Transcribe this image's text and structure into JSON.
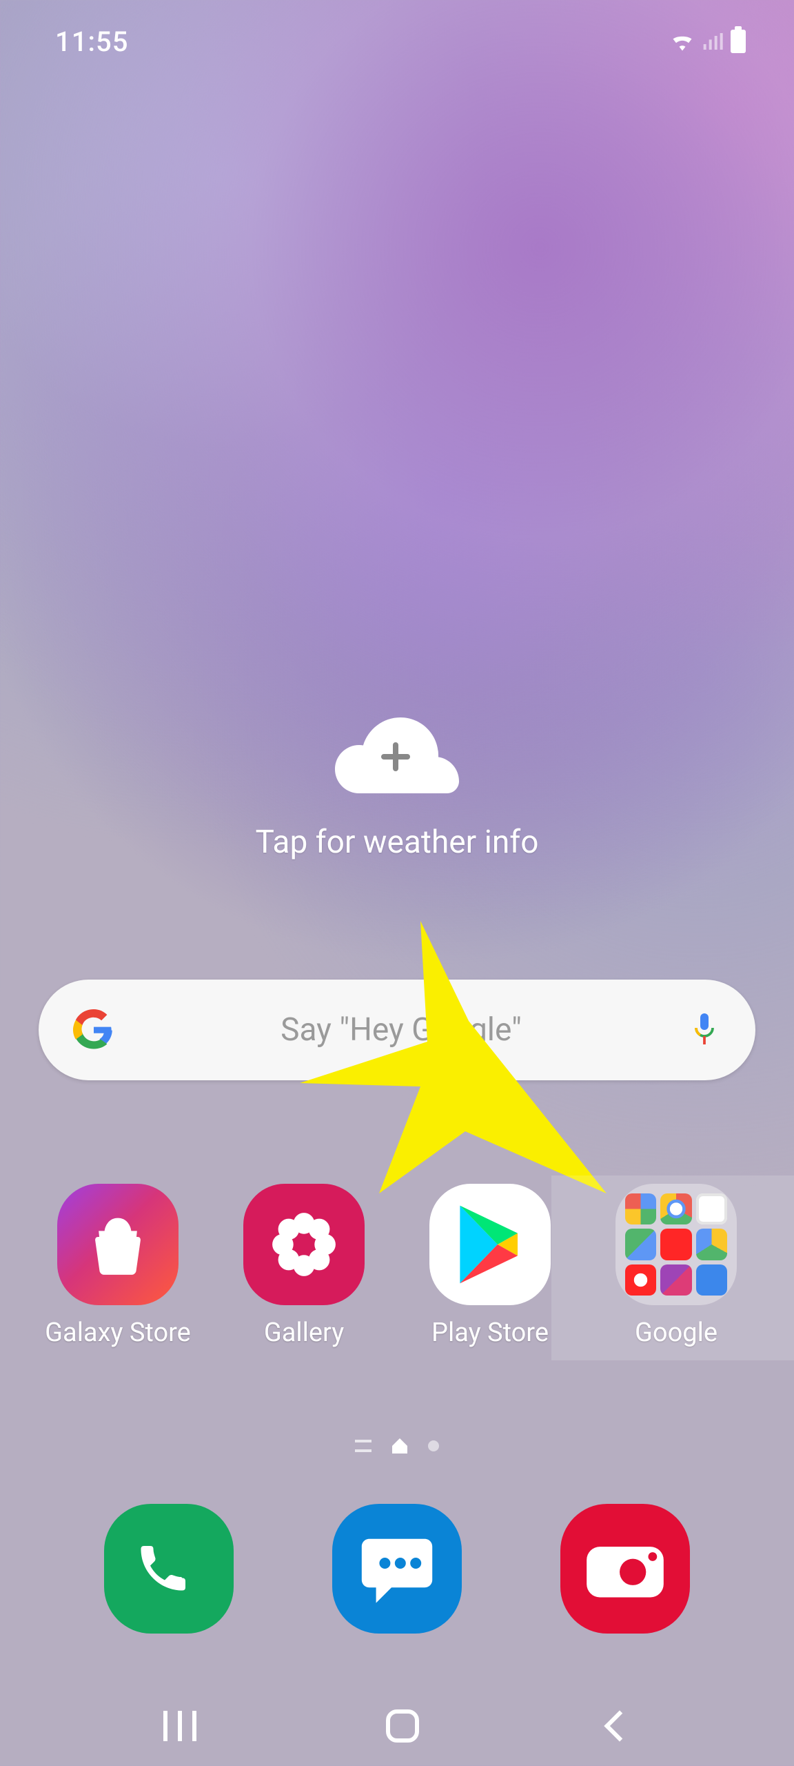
{
  "statusbar": {
    "time": "11:55"
  },
  "weather": {
    "text": "Tap for weather info"
  },
  "search": {
    "placeholder": "Say \"Hey Google\""
  },
  "apps": {
    "row": [
      {
        "name": "galaxy-store",
        "label": "Galaxy Store"
      },
      {
        "name": "gallery",
        "label": "Gallery"
      },
      {
        "name": "play-store",
        "label": "Play Store"
      },
      {
        "name": "google-folder",
        "label": "Google"
      }
    ]
  },
  "dock": [
    {
      "name": "phone"
    },
    {
      "name": "messages"
    },
    {
      "name": "camera"
    }
  ]
}
